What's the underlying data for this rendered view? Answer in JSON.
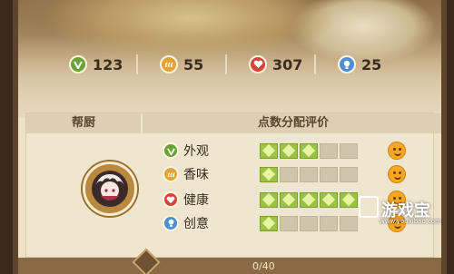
{
  "stats": [
    {
      "icon": "appearance-icon",
      "value": "123",
      "color": "#6aa336"
    },
    {
      "icon": "aroma-icon",
      "value": "55",
      "color": "#e3a33a"
    },
    {
      "icon": "health-icon",
      "value": "307",
      "color": "#d8443a"
    },
    {
      "icon": "creativity-icon",
      "value": "25",
      "color": "#4b8fd6"
    }
  ],
  "panel": {
    "helper_header": "帮厨",
    "score_header": "点数分配评价"
  },
  "attributes": [
    {
      "label": "外观",
      "icon": "appearance-icon",
      "color": "#6aa336",
      "filled": 3,
      "total": 5,
      "rating": "smile"
    },
    {
      "label": "香味",
      "icon": "aroma-icon",
      "color": "#e3a33a",
      "filled": 1,
      "total": 5,
      "rating": "smile"
    },
    {
      "label": "健康",
      "icon": "health-icon",
      "color": "#d8443a",
      "filled": 5,
      "total": 5,
      "rating": "smile"
    },
    {
      "label": "创意",
      "icon": "creativity-icon",
      "color": "#4b8fd6",
      "filled": 1,
      "total": 5,
      "rating": "smile"
    }
  ],
  "progress": "0/40",
  "watermark": {
    "text": "游戏宝",
    "sub": "www.youxibao.com"
  }
}
